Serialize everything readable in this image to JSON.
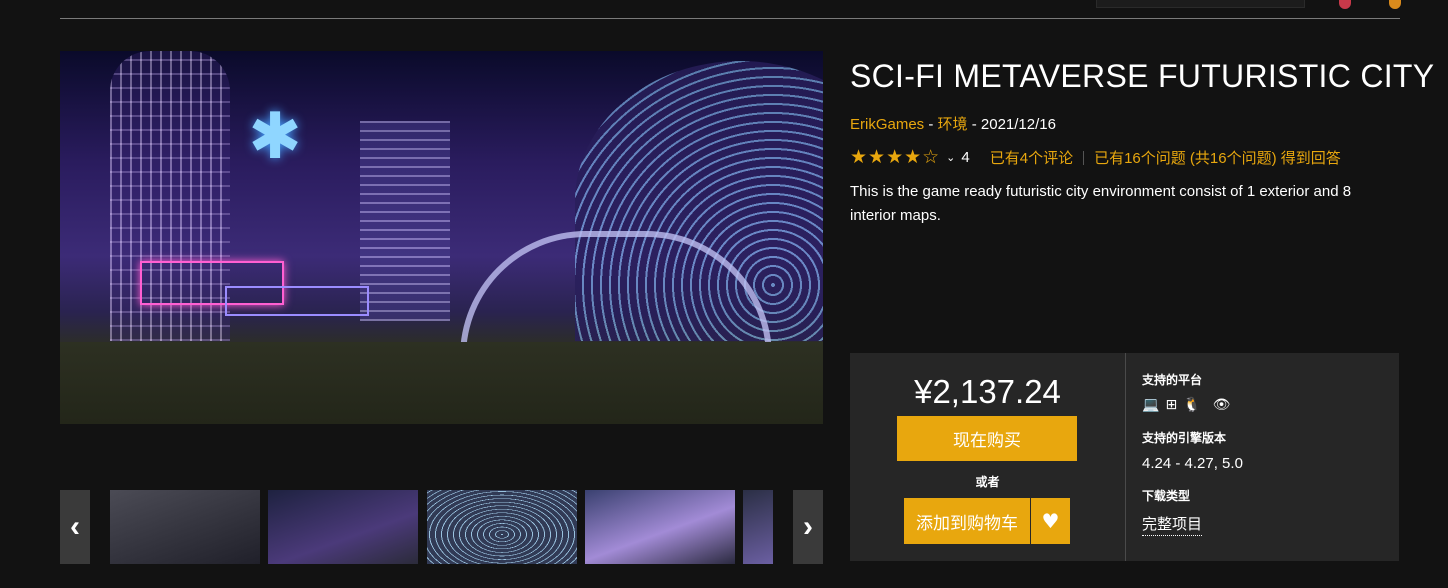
{
  "product": {
    "title": "SCI-FI METAVERSE FUTURISTIC CITY",
    "seller": "ErikGames",
    "separator1": " - ",
    "category": "环境",
    "separator2": " - ",
    "date": "2021/12/16",
    "rating": {
      "stars_filled": 4,
      "stars_total": 5,
      "score": "4",
      "reviews_link": "已有4个评论",
      "questions_link": "已有16个问题 (共16个问题) 得到回答"
    },
    "description": "This is the game ready futuristic city environment consist of 1 exterior and 8 interior maps."
  },
  "buy_box": {
    "price": "¥2,137.24",
    "buy_now": "现在购买",
    "or": "或者",
    "add_to_cart": "添加到购物车",
    "platforms_label": "支持的平台",
    "platform_icons": [
      "laptop-icon",
      "windows-icon",
      "linux-icon",
      "apple-icon",
      "eye-icon"
    ],
    "engine_label": "支持的引擎版本",
    "engine_versions": "4.24 - 4.27, 5.0",
    "download_label": "下载类型",
    "download_type": "完整项目"
  },
  "gallery": {
    "prev_icon": "chevron-left-icon",
    "next_icon": "chevron-right-icon",
    "thumbnail_count": 5
  },
  "colors": {
    "accent": "#e8a70e",
    "background": "#121212",
    "panel": "#262626"
  }
}
